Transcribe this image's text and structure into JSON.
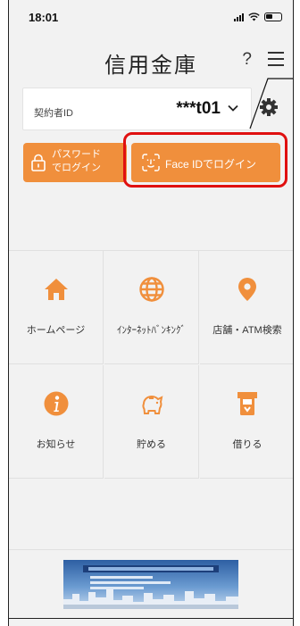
{
  "status_bar": {
    "time": "18:01"
  },
  "header": {
    "title": "信用金庫",
    "help_label": "?"
  },
  "account": {
    "label": "契約者ID",
    "value": "***t01"
  },
  "login": {
    "password_line1": "パスワード",
    "password_line2": "でログイン",
    "faceid_label": "Face IDでログイン"
  },
  "menu": [
    {
      "label": "ホームページ",
      "icon": "home-icon"
    },
    {
      "label": "ｲﾝﾀｰﾈｯﾄﾊﾞﾝｷﾝｸﾞ",
      "icon": "globe-icon"
    },
    {
      "label": "店舗・ATM検索",
      "icon": "location-pin-icon"
    },
    {
      "label": "お知らせ",
      "icon": "info-icon"
    },
    {
      "label": "貯める",
      "icon": "piggy-bank-icon"
    },
    {
      "label": "借りる",
      "icon": "atm-card-icon"
    }
  ],
  "colors": {
    "accent": "#f08f3c",
    "highlight": "#e01010",
    "background": "#f2f2f2"
  }
}
